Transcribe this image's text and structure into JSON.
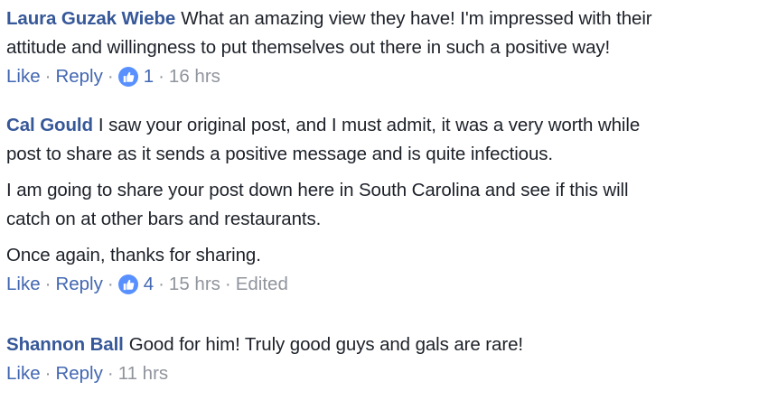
{
  "comments": [
    {
      "author": "Laura Guzak Wiebe",
      "lines": [
        "What an amazing view they have! I'm impressed with their",
        "attitude and willingness to put themselves out there in such a positive way!"
      ],
      "actions": {
        "like": "Like",
        "reply": "Reply",
        "reaction_count": "1",
        "time": "16 hrs"
      }
    },
    {
      "author": "Cal Gould",
      "paragraphs": [
        [
          "I saw your original post, and I must admit, it was a very worth while",
          "post to share as it sends a positive message and is quite infectious."
        ],
        [
          "I am going to share your post down here in South Carolina and see if this will",
          "catch on at other bars and restaurants."
        ],
        [
          "Once again, thanks for sharing."
        ]
      ],
      "actions": {
        "like": "Like",
        "reply": "Reply",
        "reaction_count": "4",
        "time": "15 hrs",
        "edited": "Edited"
      }
    },
    {
      "author": "Shannon Ball",
      "lines": [
        "Good for him! Truly good guys and gals are rare!"
      ],
      "actions": {
        "like": "Like",
        "reply": "Reply",
        "time": "11 hrs"
      }
    }
  ],
  "separator": "·",
  "icons": {
    "reaction": "like-thumb-icon"
  },
  "colors": {
    "author": "#365899",
    "link": "#4267b2",
    "meta": "#90949c",
    "badge": "#5890ff",
    "text": "#1d2129"
  }
}
